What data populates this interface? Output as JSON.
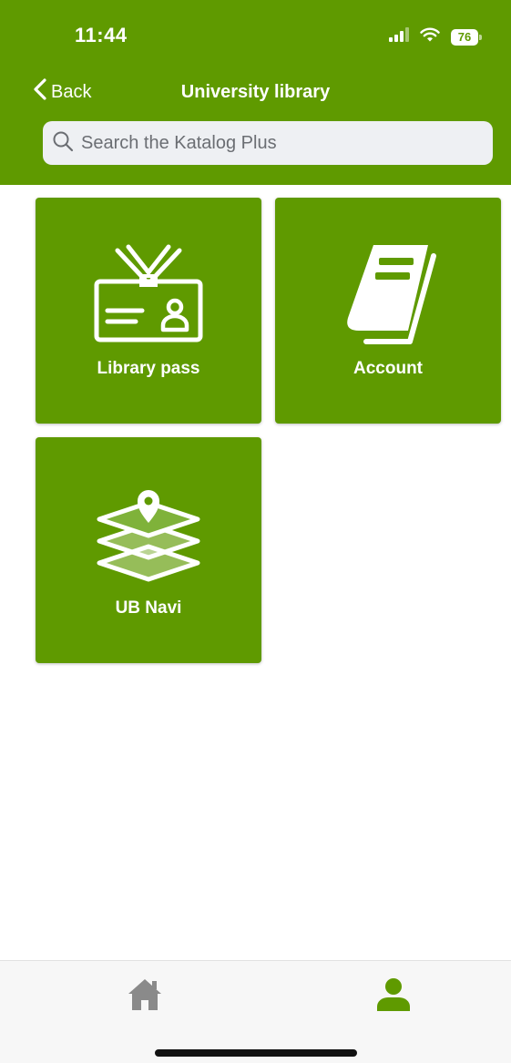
{
  "status_bar": {
    "time": "11:44",
    "battery": "76"
  },
  "nav": {
    "back_label": "Back",
    "title": "University library"
  },
  "search": {
    "placeholder": "Search the Katalog Plus",
    "value": ""
  },
  "tiles": [
    {
      "label": "Library pass",
      "icon": "id-card-icon"
    },
    {
      "label": "Account",
      "icon": "book-icon"
    },
    {
      "label": "UB Navi",
      "icon": "map-layers-icon"
    }
  ],
  "tab_bar": {
    "items": [
      {
        "icon": "home-icon",
        "active": false
      },
      {
        "icon": "person-icon",
        "active": true
      }
    ]
  },
  "colors": {
    "brand": "#5f9a00",
    "tab_inactive": "#8a8a8a",
    "tab_active": "#5f9a00"
  }
}
